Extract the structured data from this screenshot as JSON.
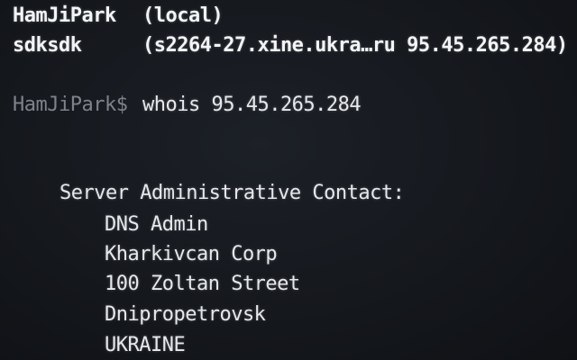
{
  "terminal": {
    "who_rows": [
      {
        "user": "HamJiPark",
        "host": "(local)"
      },
      {
        "user": "sdksdk",
        "host": "(s2264-27.xine.ukra…ru 95.45.265.284)"
      }
    ],
    "prompt": "HamJiPark$",
    "command": "whois 95.45.265.284",
    "contact": {
      "heading": "Server Administrative Contact:",
      "lines": [
        "DNS Admin",
        "Kharkivcan Corp",
        "100 Zoltan Street",
        "Dnipropetrovsk",
        "UKRAINE"
      ]
    }
  },
  "colors": {
    "background": "#15181d",
    "text": "#e6e8eb",
    "prompt_dim": "#7d838b"
  }
}
